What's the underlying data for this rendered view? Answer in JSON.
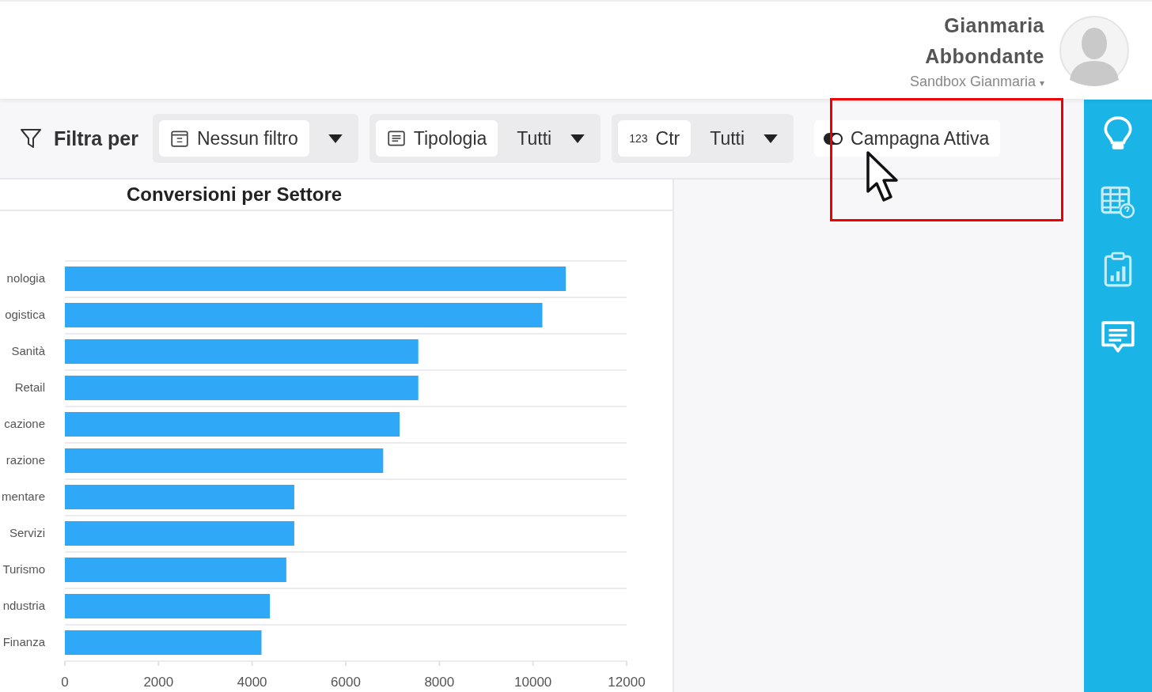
{
  "user": {
    "name": "Gianmaria Abbondante",
    "workspace": "Sandbox Gianmaria",
    "caret": "▾"
  },
  "filter_bar": {
    "label": "Filtra per",
    "filters": [
      {
        "kind": "date",
        "label": "Nessun filtro"
      },
      {
        "kind": "text",
        "label": "Tipologia",
        "value": "Tutti"
      },
      {
        "kind": "number",
        "label": "Ctr",
        "icon_text": "123",
        "value": "Tutti"
      }
    ],
    "toggle": {
      "label": "Campagna Attiva",
      "on": true
    }
  },
  "chart": {
    "title": "Conversioni per Settore",
    "chart_data": {
      "type": "bar",
      "orientation": "horizontal",
      "categories": [
        "nologia",
        "ogistica",
        "Sanità",
        "Retail",
        "cazione",
        "razione",
        "mentare",
        "Servizi",
        "Turismo",
        "ndustria",
        "Finanza"
      ],
      "series": [
        {
          "color": "#2fa9f7",
          "values": [
            10700,
            10200,
            7550,
            7550,
            7150,
            6800,
            4900,
            4900,
            4730,
            4380,
            4200
          ]
        }
      ],
      "xlim": [
        0,
        12000
      ],
      "xticks": [
        0,
        2000,
        4000,
        6000,
        8000,
        10000,
        12000
      ]
    }
  }
}
